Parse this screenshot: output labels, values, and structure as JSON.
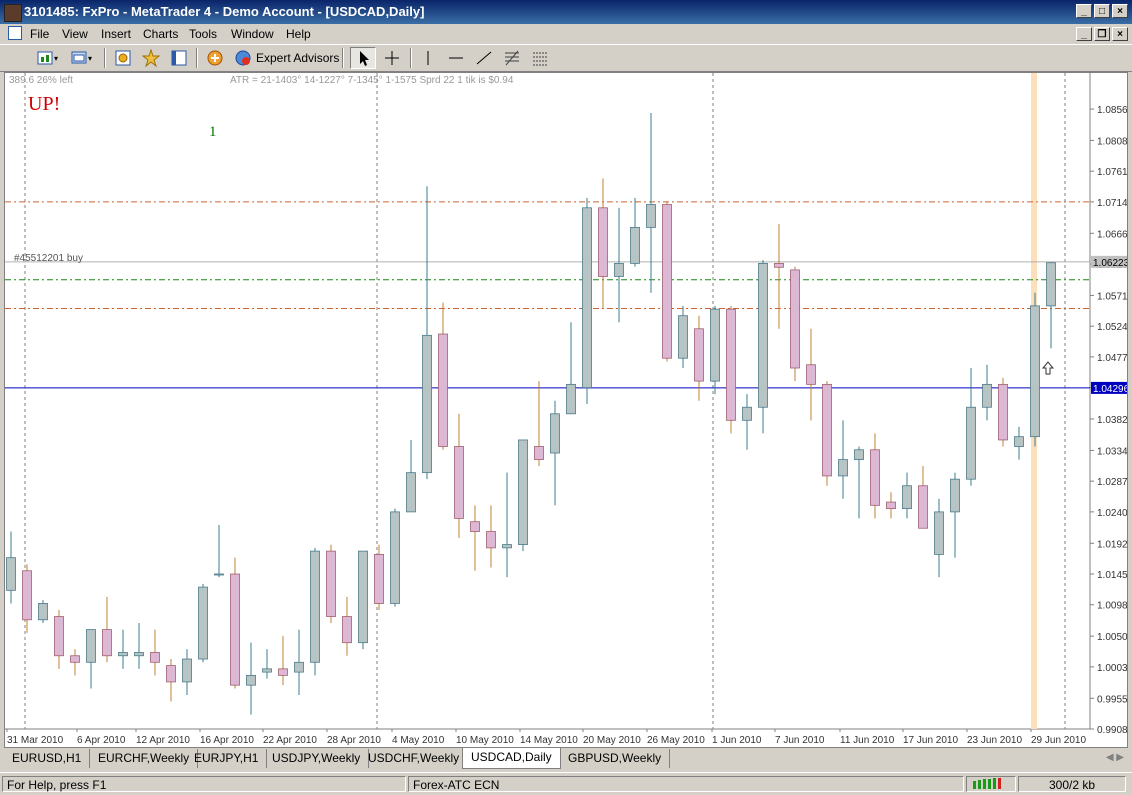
{
  "window": {
    "title": "3101485: FxPro - MetaTrader 4 - Demo Account - [USDCAD,Daily]"
  },
  "menu": [
    "File",
    "View",
    "Insert",
    "Charts",
    "Tools",
    "Window",
    "Help"
  ],
  "toolbar": {
    "expert_advisors_label": "Expert Advisors"
  },
  "chart": {
    "corner_info": "389.6  26% left",
    "indicator_text": "ATR = 21-1403° 14-1227° 7-1345° 1-1575  Sprd 22 1 tik is $0.94",
    "signal_text": "UP!",
    "signal_color": "#d40000",
    "counter_text": "1",
    "counter_color": "#007000",
    "order_label": "#45512201 buy",
    "bull_color": "#b8c4c4",
    "bear_color": "#dcb8d4",
    "wick_bull_color": "#3a7c8c",
    "wick_bear_color": "#c08030"
  },
  "chart_data": {
    "type": "candlestick",
    "symbol": "USDCAD",
    "timeframe": "Daily",
    "y_ticks": [
      "1.08560",
      "1.08080",
      "1.07610",
      "1.07140",
      "1.06660",
      "1.06190",
      "1.05710",
      "1.05240",
      "1.04770",
      "1.04300",
      "1.03820",
      "1.03340",
      "1.02870",
      "1.02400",
      "1.01920",
      "1.01450",
      "1.00980",
      "1.00500",
      "1.00030",
      "0.99550",
      "0.99080"
    ],
    "x_labels": [
      "31 Mar 2010",
      "6 Apr 2010",
      "12 Apr 2010",
      "16 Apr 2010",
      "22 Apr 2010",
      "28 Apr 2010",
      "4 May 2010",
      "10 May 2010",
      "14 May 2010",
      "20 May 2010",
      "26 May 2010",
      "1 Jun 2010",
      "7 Jun 2010",
      "11 Jun 2010",
      "17 Jun 2010",
      "23 Jun 2010",
      "29 Jun 2010"
    ],
    "ylim": [
      0.9908,
      1.0905
    ],
    "price_current": {
      "value": 1.06223,
      "label": "1.06223"
    },
    "price_line": {
      "value": 1.04296,
      "label": "1.04296"
    },
    "levels": [
      {
        "kind": "resistance",
        "value": 1.0714
      },
      {
        "kind": "order",
        "value": 1.0595
      },
      {
        "kind": "support",
        "value": 1.0551
      }
    ],
    "candles": [
      {
        "o": 1.012,
        "h": 1.021,
        "l": 1.01,
        "c": 1.017
      },
      {
        "o": 1.015,
        "h": 1.016,
        "l": 1.0055,
        "c": 1.0075
      },
      {
        "o": 1.0075,
        "h": 1.0105,
        "l": 1.007,
        "c": 1.01
      },
      {
        "o": 1.008,
        "h": 1.009,
        "l": 1.0,
        "c": 1.002
      },
      {
        "o": 1.002,
        "h": 1.003,
        "l": 0.999,
        "c": 1.001
      },
      {
        "o": 1.001,
        "h": 1.006,
        "l": 0.997,
        "c": 1.006
      },
      {
        "o": 1.006,
        "h": 1.011,
        "l": 1.001,
        "c": 1.002
      },
      {
        "o": 1.002,
        "h": 1.006,
        "l": 1.0,
        "c": 1.0025
      },
      {
        "o": 1.002,
        "h": 1.007,
        "l": 1.0,
        "c": 1.0025
      },
      {
        "o": 1.0025,
        "h": 1.006,
        "l": 0.999,
        "c": 1.001
      },
      {
        "o": 1.0005,
        "h": 1.0015,
        "l": 0.995,
        "c": 0.998
      },
      {
        "o": 0.998,
        "h": 1.003,
        "l": 0.996,
        "c": 1.0015
      },
      {
        "o": 1.0015,
        "h": 1.013,
        "l": 1.001,
        "c": 1.0125
      },
      {
        "o": 1.0145,
        "h": 1.022,
        "l": 1.014,
        "c": 1.0145
      },
      {
        "o": 1.0145,
        "h": 1.017,
        "l": 0.997,
        "c": 0.9975
      },
      {
        "o": 0.9975,
        "h": 1.004,
        "l": 0.993,
        "c": 0.999
      },
      {
        "o": 0.9995,
        "h": 1.003,
        "l": 0.9985,
        "c": 1.0
      },
      {
        "o": 1.0,
        "h": 1.005,
        "l": 0.9975,
        "c": 0.999
      },
      {
        "o": 0.9995,
        "h": 1.006,
        "l": 0.996,
        "c": 1.001
      },
      {
        "o": 1.001,
        "h": 1.0185,
        "l": 0.999,
        "c": 1.018
      },
      {
        "o": 1.018,
        "h": 1.019,
        "l": 1.007,
        "c": 1.008
      },
      {
        "o": 1.008,
        "h": 1.011,
        "l": 1.002,
        "c": 1.004
      },
      {
        "o": 1.004,
        "h": 1.018,
        "l": 1.003,
        "c": 1.018
      },
      {
        "o": 1.0175,
        "h": 1.019,
        "l": 1.009,
        "c": 1.01
      },
      {
        "o": 1.01,
        "h": 1.0245,
        "l": 1.0095,
        "c": 1.024
      },
      {
        "o": 1.024,
        "h": 1.035,
        "l": 1.024,
        "c": 1.03
      },
      {
        "o": 1.03,
        "h": 1.0738,
        "l": 1.029,
        "c": 1.051
      },
      {
        "o": 1.0512,
        "h": 1.056,
        "l": 1.0335,
        "c": 1.034
      },
      {
        "o": 1.034,
        "h": 1.039,
        "l": 1.02,
        "c": 1.023
      },
      {
        "o": 1.0225,
        "h": 1.025,
        "l": 1.015,
        "c": 1.021
      },
      {
        "o": 1.021,
        "h": 1.025,
        "l": 1.0155,
        "c": 1.0185
      },
      {
        "o": 1.0185,
        "h": 1.03,
        "l": 1.014,
        "c": 1.019
      },
      {
        "o": 1.019,
        "h": 1.035,
        "l": 1.018,
        "c": 1.035
      },
      {
        "o": 1.034,
        "h": 1.044,
        "l": 1.031,
        "c": 1.032
      },
      {
        "o": 1.033,
        "h": 1.041,
        "l": 1.025,
        "c": 1.039
      },
      {
        "o": 1.039,
        "h": 1.053,
        "l": 1.039,
        "c": 1.0435
      },
      {
        "o": 1.043,
        "h": 1.072,
        "l": 1.0405,
        "c": 1.0705
      },
      {
        "o": 1.0705,
        "h": 1.075,
        "l": 1.055,
        "c": 1.06
      },
      {
        "o": 1.06,
        "h": 1.0705,
        "l": 1.053,
        "c": 1.062
      },
      {
        "o": 1.062,
        "h": 1.072,
        "l": 1.0615,
        "c": 1.0675
      },
      {
        "o": 1.0675,
        "h": 1.085,
        "l": 1.0575,
        "c": 1.071
      },
      {
        "o": 1.071,
        "h": 1.0715,
        "l": 1.047,
        "c": 1.0475
      },
      {
        "o": 1.0475,
        "h": 1.0555,
        "l": 1.046,
        "c": 1.054
      },
      {
        "o": 1.052,
        "h": 1.054,
        "l": 1.041,
        "c": 1.044
      },
      {
        "o": 1.044,
        "h": 1.0555,
        "l": 1.042,
        "c": 1.055
      },
      {
        "o": 1.055,
        "h": 1.0555,
        "l": 1.036,
        "c": 1.038
      },
      {
        "o": 1.038,
        "h": 1.042,
        "l": 1.0335,
        "c": 1.04
      },
      {
        "o": 1.04,
        "h": 1.0625,
        "l": 1.036,
        "c": 1.062
      },
      {
        "o": 1.062,
        "h": 1.068,
        "l": 1.052,
        "c": 1.0614
      },
      {
        "o": 1.061,
        "h": 1.0615,
        "l": 1.044,
        "c": 1.046
      },
      {
        "o": 1.0465,
        "h": 1.052,
        "l": 1.038,
        "c": 1.0435
      },
      {
        "o": 1.0435,
        "h": 1.044,
        "l": 1.028,
        "c": 1.0295
      },
      {
        "o": 1.0295,
        "h": 1.038,
        "l": 1.026,
        "c": 1.032
      },
      {
        "o": 1.032,
        "h": 1.034,
        "l": 1.023,
        "c": 1.0335
      },
      {
        "o": 1.0335,
        "h": 1.036,
        "l": 1.023,
        "c": 1.025
      },
      {
        "o": 1.0255,
        "h": 1.027,
        "l": 1.023,
        "c": 1.0245
      },
      {
        "o": 1.0245,
        "h": 1.03,
        "l": 1.023,
        "c": 1.028
      },
      {
        "o": 1.028,
        "h": 1.031,
        "l": 1.022,
        "c": 1.0215
      },
      {
        "o": 1.0175,
        "h": 1.026,
        "l": 1.014,
        "c": 1.024
      },
      {
        "o": 1.024,
        "h": 1.03,
        "l": 1.017,
        "c": 1.029
      },
      {
        "o": 1.029,
        "h": 1.046,
        "l": 1.028,
        "c": 1.04
      },
      {
        "o": 1.04,
        "h": 1.0465,
        "l": 1.038,
        "c": 1.0435
      },
      {
        "o": 1.0435,
        "h": 1.0445,
        "l": 1.034,
        "c": 1.035
      },
      {
        "o": 1.034,
        "h": 1.037,
        "l": 1.032,
        "c": 1.0355
      },
      {
        "o": 1.0355,
        "h": 1.0575,
        "l": 1.034,
        "c": 1.0555
      },
      {
        "o": 1.0555,
        "h": 1.062,
        "l": 1.049,
        "c": 1.0621
      }
    ]
  },
  "tabs": [
    {
      "label": "EURUSD,H1",
      "active": false
    },
    {
      "label": "EURCHF,Weekly",
      "active": false
    },
    {
      "label": "EURJPY,H1",
      "active": false
    },
    {
      "label": "USDJPY,Weekly",
      "active": false
    },
    {
      "label": "USDCHF,Weekly",
      "active": false
    },
    {
      "label": "USDCAD,Daily",
      "active": true
    },
    {
      "label": "GBPUSD,Weekly",
      "active": false
    }
  ],
  "status": {
    "help": "For Help, press F1",
    "profile": "Forex-ATC ECN",
    "traffic": "300/2 kb"
  },
  "icons": [
    "new-chart-icon",
    "profiles-icon",
    "market-watch-icon",
    "navigator-icon",
    "terminal-icon",
    "new-order-icon",
    "expert-advisors-icon",
    "cursor-icon",
    "crosshair-icon",
    "vertical-line-icon",
    "horizontal-line-icon",
    "trendline-icon",
    "fibonacci-icon",
    "grid-icon"
  ]
}
